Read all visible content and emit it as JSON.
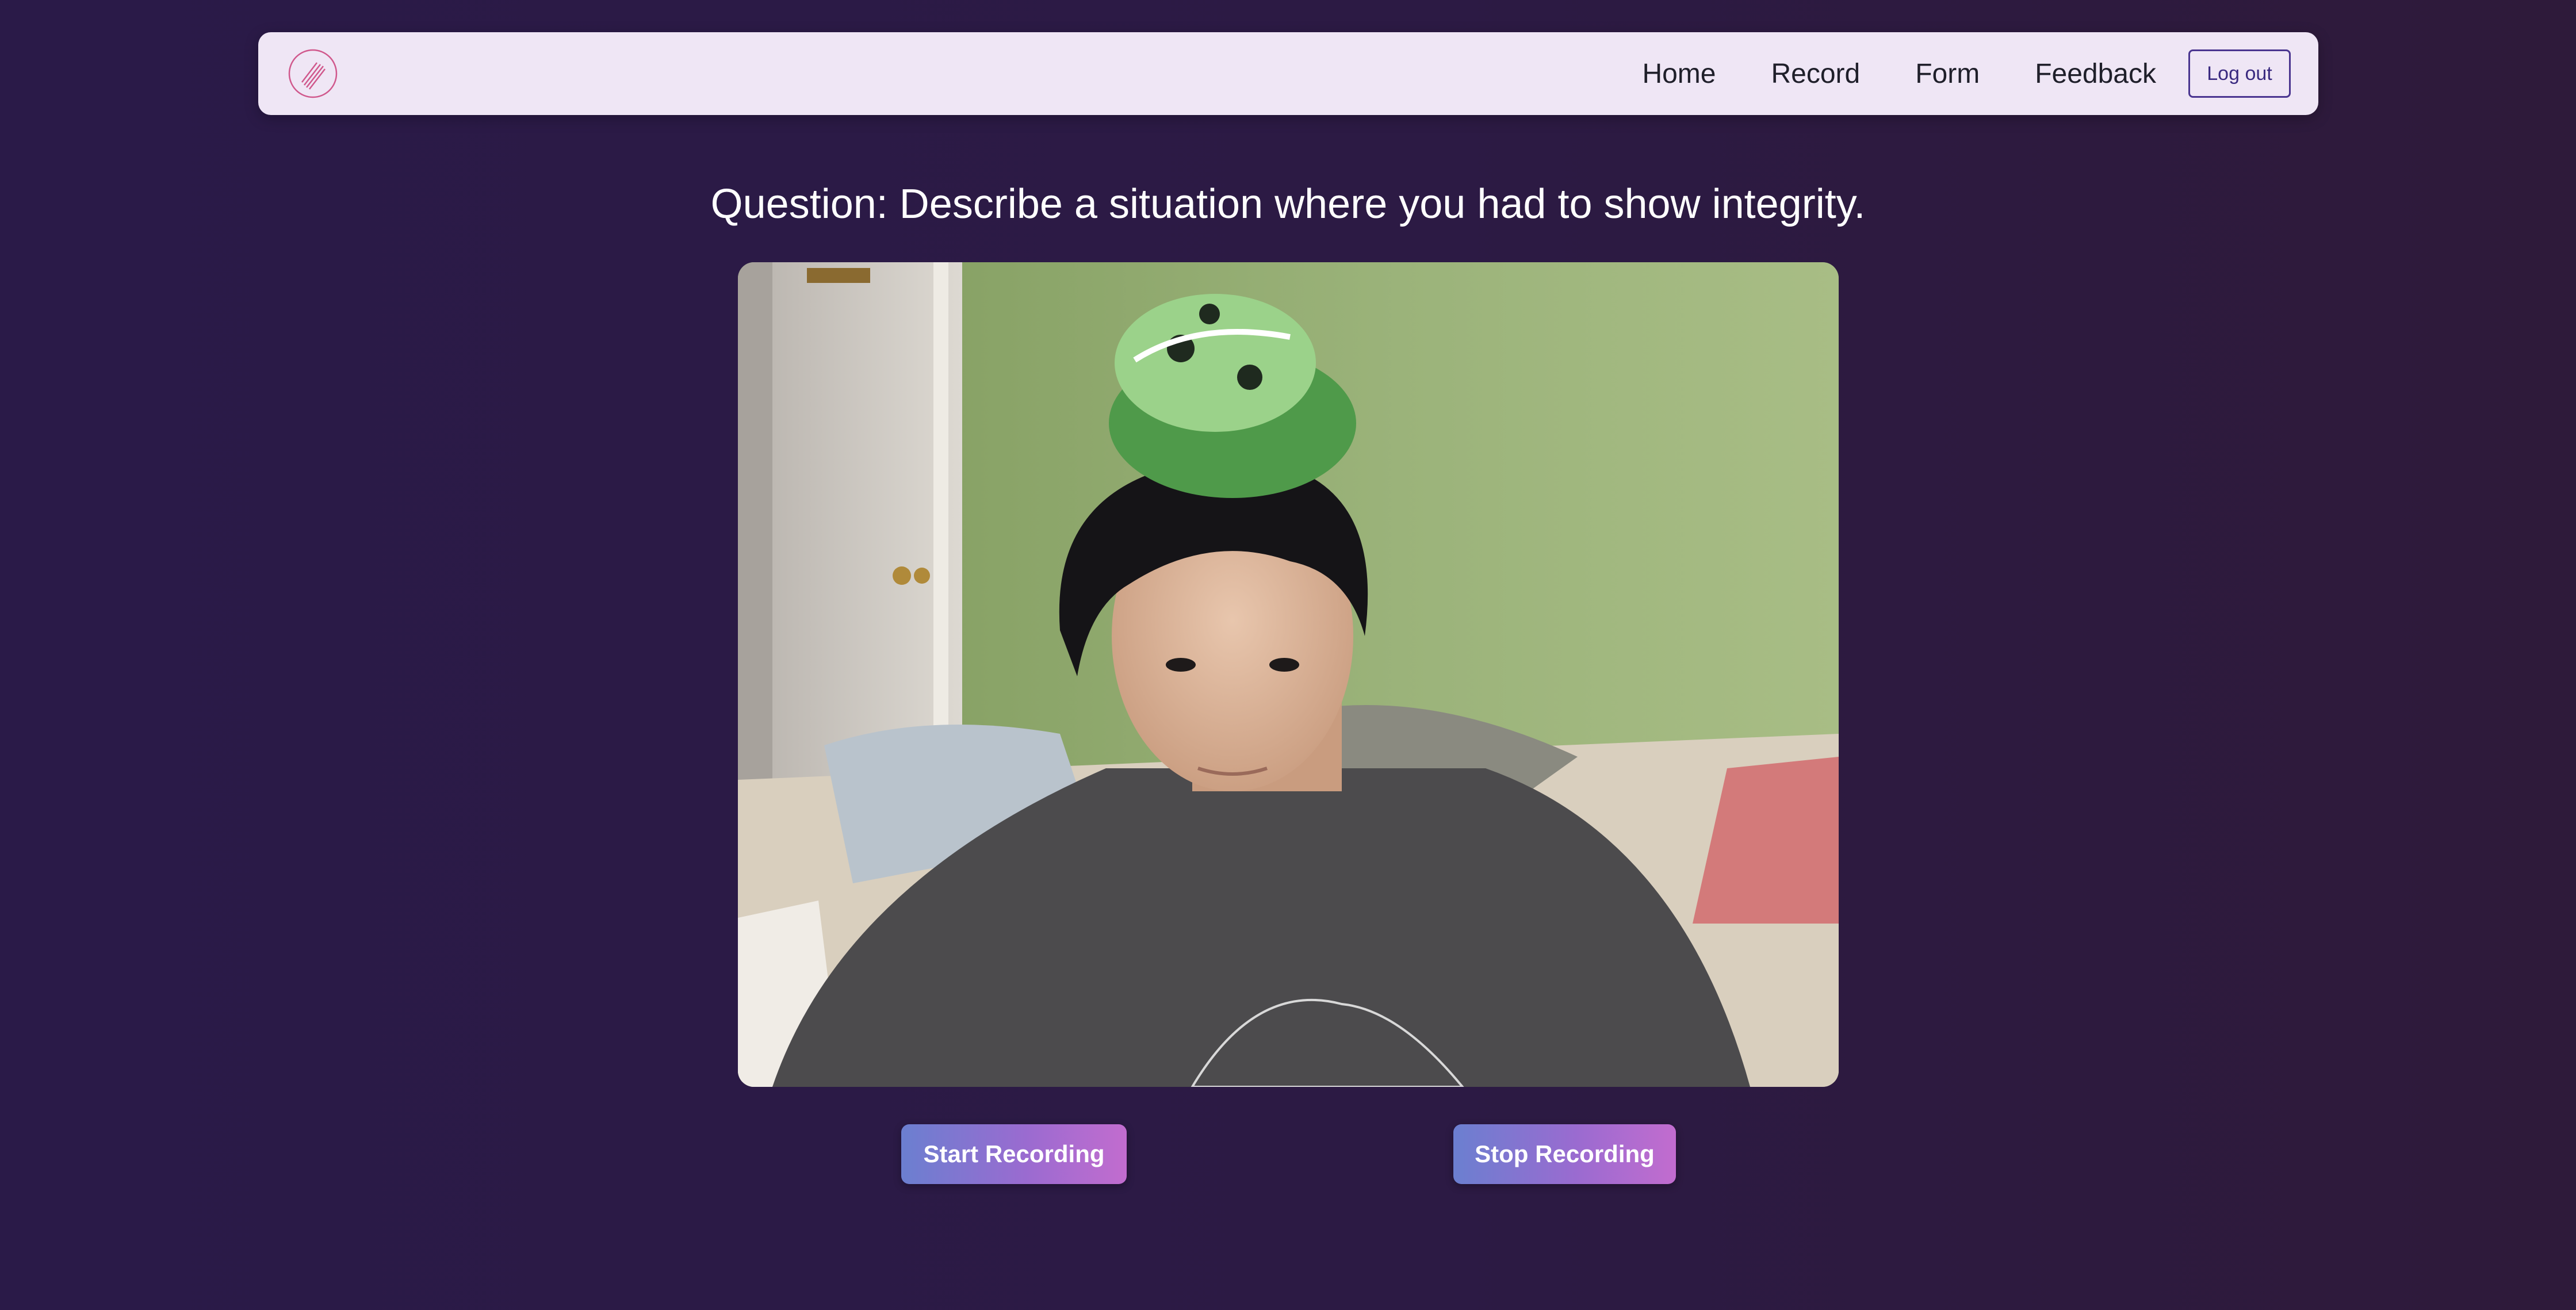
{
  "nav": {
    "logo_icon": "striped-circle-logo",
    "links": [
      "Home",
      "Record",
      "Form",
      "Feedback"
    ],
    "logout_label": "Log out"
  },
  "question": {
    "text": "Question: Describe a situation where you had to show integrity."
  },
  "video": {
    "subject": "webcam-preview"
  },
  "controls": {
    "start_label": "Start Recording",
    "stop_label": "Stop Recording"
  },
  "colors": {
    "background": "#2b1a46",
    "navbar": "#efe6f5",
    "logout_border": "#4a3590",
    "button_gradient_start": "#6b7fd0",
    "button_gradient_end": "#c26ccf",
    "logo_stroke": "#d0588c"
  }
}
